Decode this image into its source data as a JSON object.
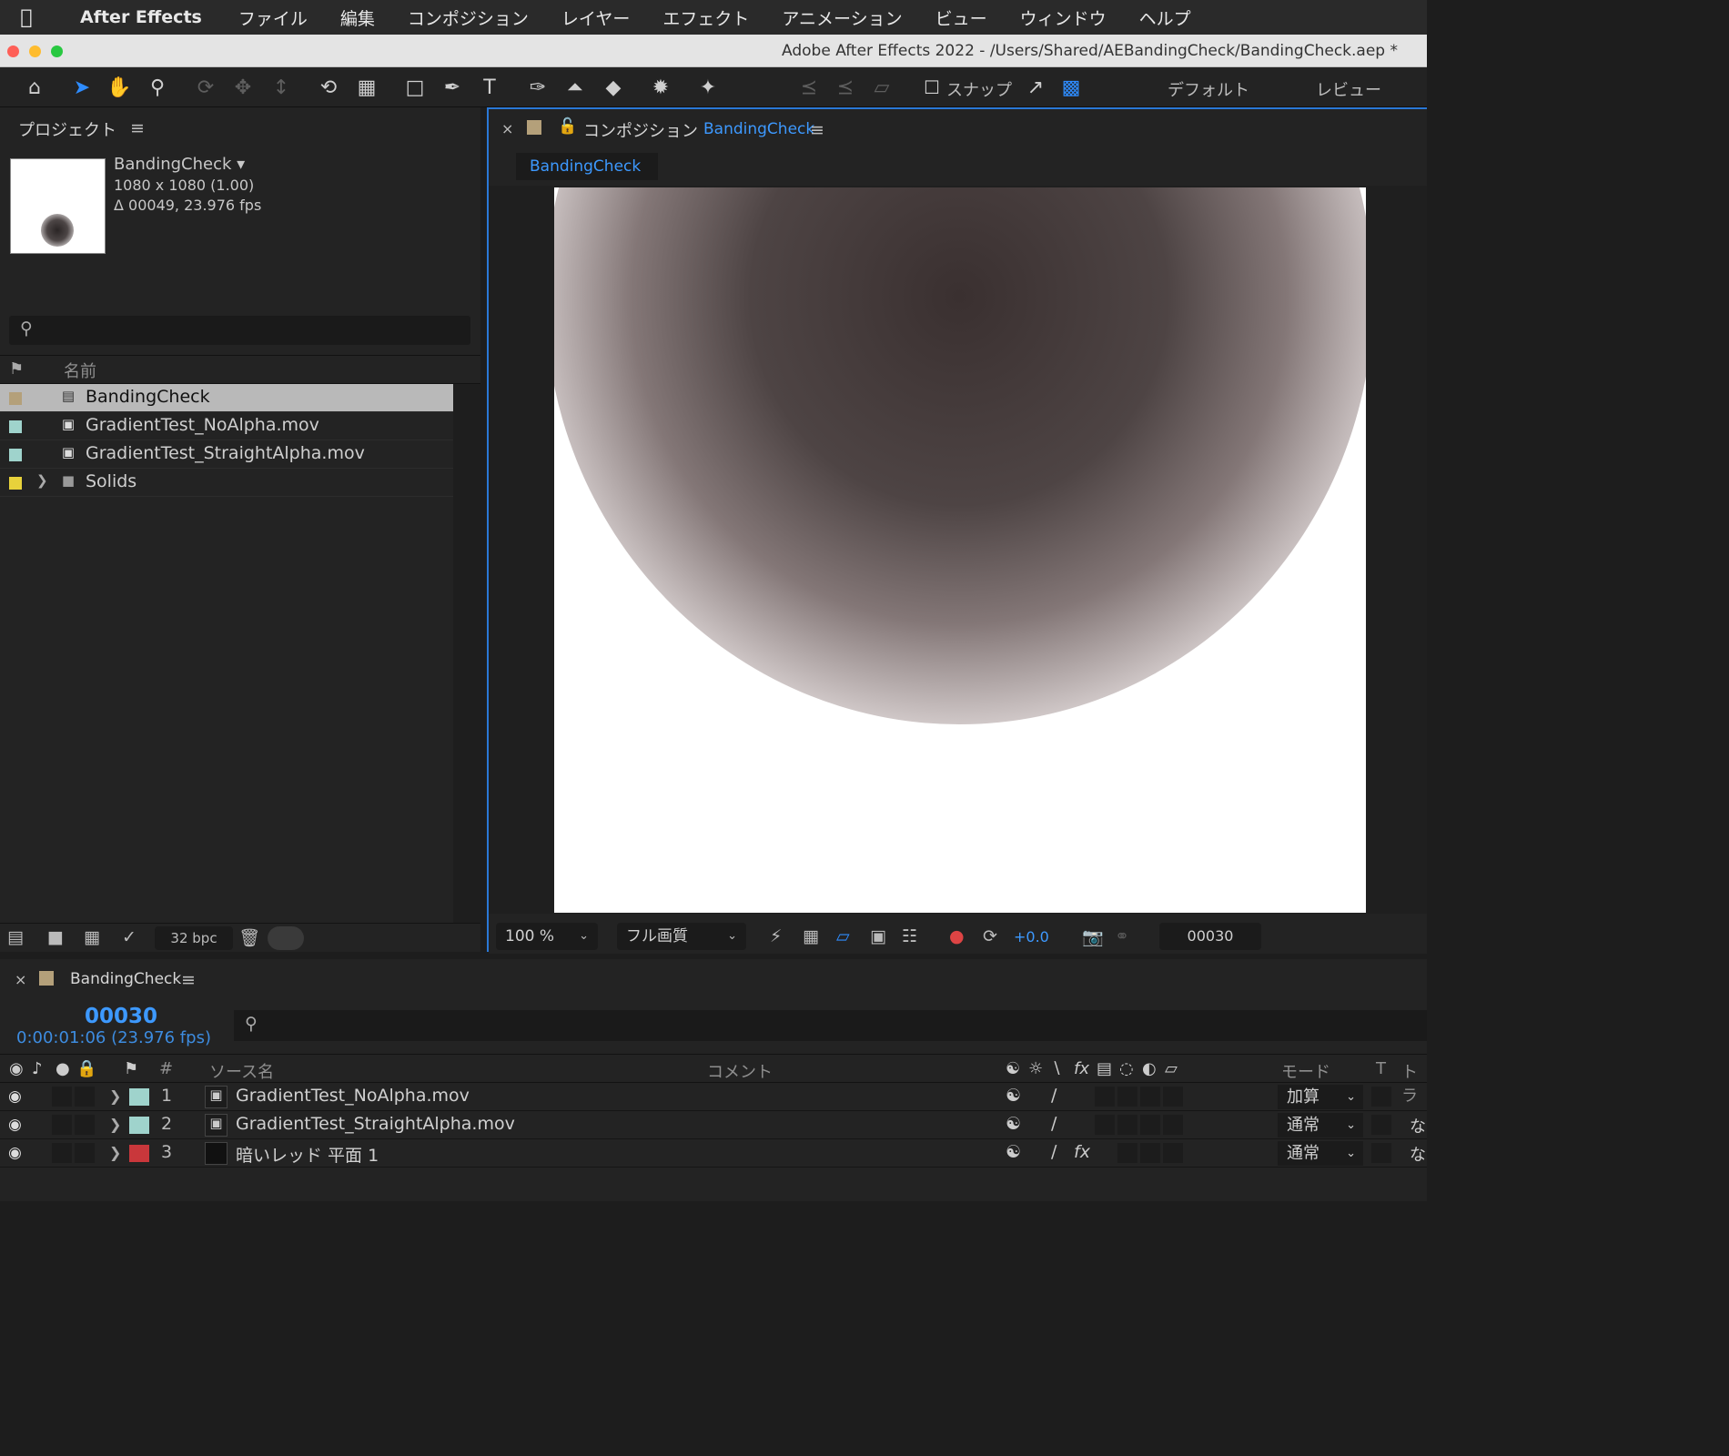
{
  "menubar": {
    "app": "After Effects",
    "items": [
      "ファイル",
      "編集",
      "コンポジション",
      "レイヤー",
      "エフェクト",
      "アニメーション",
      "ビュー",
      "ウィンドウ",
      "ヘルプ"
    ]
  },
  "window": {
    "title": "Adobe After Effects 2022 - /Users/Shared/AEBandingCheck/BandingCheck.aep *"
  },
  "toolbar": {
    "snap_label": "スナップ",
    "workspace_default": "デフォルト",
    "workspace_review": "レビュー"
  },
  "project": {
    "title": "プロジェクト",
    "selected": {
      "name": "BandingCheck ▾",
      "size": "1080 x 1080 (1.00)",
      "duration": "Δ 00049, 23.976 fps"
    },
    "col_name": "名前",
    "items": [
      {
        "name": "BandingCheck",
        "label_color": "#b4a07a",
        "icon": "composition-icon",
        "selected": true
      },
      {
        "name": "GradientTest_NoAlpha.mov",
        "label_color": "#9fd3cc",
        "icon": "footage-icon"
      },
      {
        "name": "GradientTest_StraightAlpha.mov",
        "label_color": "#9fd3cc",
        "icon": "footage-icon"
      },
      {
        "name": "Solids",
        "label_color": "#e8d23b",
        "icon": "folder-icon"
      }
    ],
    "bpc": "32 bpc"
  },
  "comp_panel": {
    "label": "コンポジション",
    "comp_name": "BandingCheck",
    "tab": "BandingCheck",
    "zoom": "100 %",
    "quality": "フル画質",
    "exposure": "+0.0",
    "frame": "00030"
  },
  "timeline": {
    "tab": "BandingCheck",
    "timecode": "00030",
    "time_detail": "0:00:01:06 (23.976 fps)",
    "headers": {
      "num": "#",
      "source": "ソース名",
      "comment": "コメント",
      "mode": "モード",
      "t": "T",
      "trkmat": "トラ"
    },
    "layers": [
      {
        "num": "1",
        "name": "GradientTest_NoAlpha.mov",
        "label_color": "#9fd3cc",
        "mode": "加算",
        "trkmat": "",
        "fx": false
      },
      {
        "num": "2",
        "name": "GradientTest_StraightAlpha.mov",
        "label_color": "#9fd3cc",
        "mode": "通常",
        "trkmat": "な",
        "fx": false
      },
      {
        "num": "3",
        "name": "暗いレッド 平面 1",
        "label_color": "#c9373b",
        "mode": "通常",
        "trkmat": "な",
        "fx": true
      }
    ]
  },
  "colors": {
    "accent": "#2e8cff",
    "panel_bg": "#232323",
    "selection": "#b9b9b9"
  }
}
